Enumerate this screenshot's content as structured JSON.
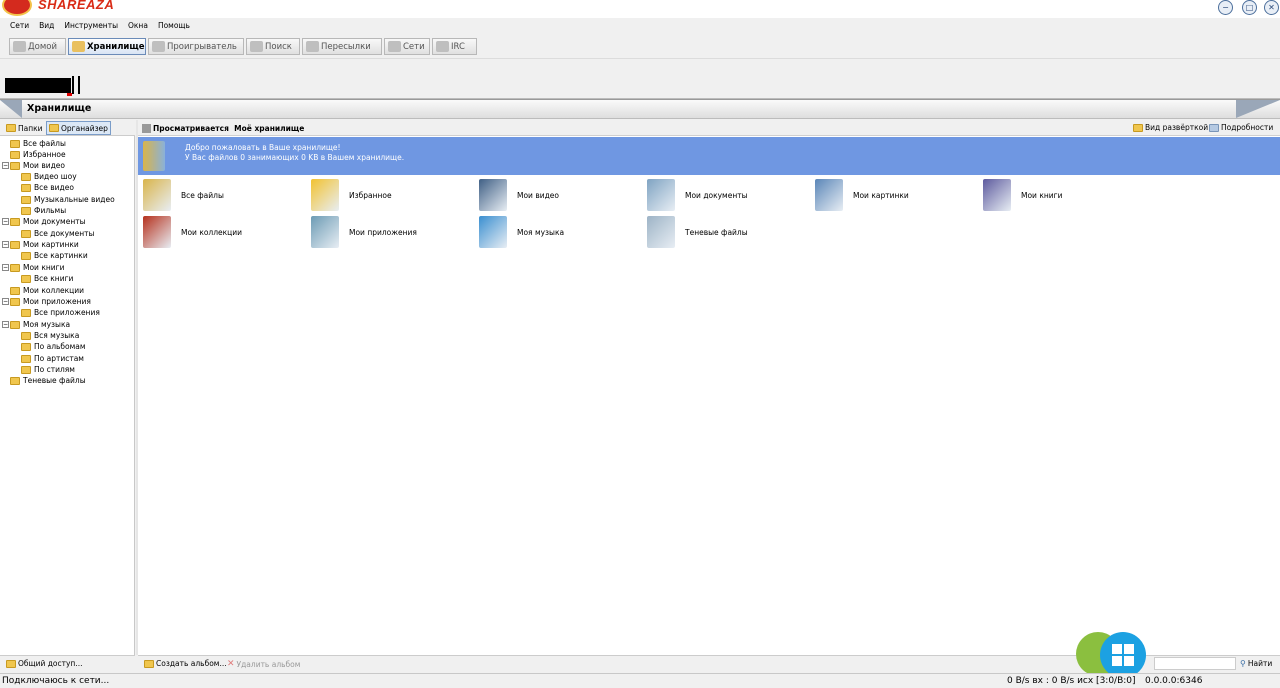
{
  "app": {
    "name": "SHAREAZA"
  },
  "window": {
    "minimize": "−",
    "maximize": "□",
    "close": "✕"
  },
  "menu": {
    "items": [
      {
        "label": "Сети"
      },
      {
        "label": "Вид"
      },
      {
        "label": "Инструменты"
      },
      {
        "label": "Окна"
      },
      {
        "label": "Помощь"
      }
    ]
  },
  "toolbar": {
    "buttons": [
      {
        "label": "Домой",
        "icon": "home-icon"
      },
      {
        "label": "Хранилище",
        "icon": "folder-icon",
        "active": true
      },
      {
        "label": "Проигрыватель",
        "icon": "player-icon"
      },
      {
        "label": "Поиск",
        "icon": "search-icon"
      },
      {
        "label": "Пересылки",
        "icon": "transfers-icon"
      },
      {
        "label": "Сети",
        "icon": "network-icon"
      },
      {
        "label": "IRC",
        "icon": "chat-icon"
      }
    ]
  },
  "section": {
    "title": "Хранилище"
  },
  "left": {
    "tabs": [
      {
        "label": "Папки"
      },
      {
        "label": "Органайзер",
        "active": true
      }
    ],
    "tree": [
      {
        "label": "Все файлы",
        "level": 0
      },
      {
        "label": "Избранное",
        "level": 0
      },
      {
        "label": "Мои видео",
        "level": 0,
        "expandable": true
      },
      {
        "label": "Видео шоу",
        "level": 1
      },
      {
        "label": "Все видео",
        "level": 1
      },
      {
        "label": "Музыкальные видео",
        "level": 1
      },
      {
        "label": "Фильмы",
        "level": 1
      },
      {
        "label": "Мои документы",
        "level": 0,
        "expandable": true
      },
      {
        "label": "Все документы",
        "level": 1
      },
      {
        "label": "Мои картинки",
        "level": 0,
        "expandable": true
      },
      {
        "label": "Все картинки",
        "level": 1
      },
      {
        "label": "Мои книги",
        "level": 0,
        "expandable": true
      },
      {
        "label": "Все книги",
        "level": 1
      },
      {
        "label": "Мои коллекции",
        "level": 0
      },
      {
        "label": "Мои приложения",
        "level": 0,
        "expandable": true
      },
      {
        "label": "Все приложения",
        "level": 1
      },
      {
        "label": "Моя музыка",
        "level": 0,
        "expandable": true
      },
      {
        "label": "Вся музыка",
        "level": 1
      },
      {
        "label": "По альбомам",
        "level": 1
      },
      {
        "label": "По артистам",
        "level": 1
      },
      {
        "label": "По стилям",
        "level": 1
      },
      {
        "label": "Теневые файлы",
        "level": 0
      }
    ],
    "footer": {
      "share_label": "Общий доступ..."
    }
  },
  "main": {
    "viewing_label": "Просматривается",
    "viewing_value": "Моё хранилище",
    "view_expanded": "Вид развёрткой",
    "details": "Подробности",
    "welcome_line1": "Добро пожаловать в Ваше хранилище!",
    "welcome_line2": "У Вас файлов 0 занимающих 0 KB в Вашем хранилище.",
    "items": [
      {
        "label": "Все файлы",
        "icon": "all-files-icon",
        "color": "#d9b44a"
      },
      {
        "label": "Избранное",
        "icon": "star-icon",
        "color": "#f2c230"
      },
      {
        "label": "Мои видео",
        "icon": "video-icon",
        "color": "#3f5f85"
      },
      {
        "label": "Мои документы",
        "icon": "documents-icon",
        "color": "#7fa3c2"
      },
      {
        "label": "Мои картинки",
        "icon": "pictures-icon",
        "color": "#5a86b8"
      },
      {
        "label": "Мои книги",
        "icon": "books-icon",
        "color": "#5d5a9e"
      },
      {
        "label": "Мои коллекции",
        "icon": "collections-icon",
        "color": "#b5301c"
      },
      {
        "label": "Мои приложения",
        "icon": "applications-icon",
        "color": "#6c9bb4"
      },
      {
        "label": "Моя музыка",
        "icon": "music-icon",
        "color": "#3a8fd0"
      },
      {
        "label": "Теневые файлы",
        "icon": "recycle-bin-icon",
        "color": "#9db3c6"
      }
    ],
    "footer": {
      "create_album": "Создать альбом...",
      "delete_album": "Удалить альбом"
    }
  },
  "status": {
    "connecting": "Подключаюсь к сети...",
    "bandwidth": "0 B/s вх : 0 B/s исх [3:0/В:0]",
    "address": "0.0.0.0:6346",
    "search_button": "Найти"
  }
}
